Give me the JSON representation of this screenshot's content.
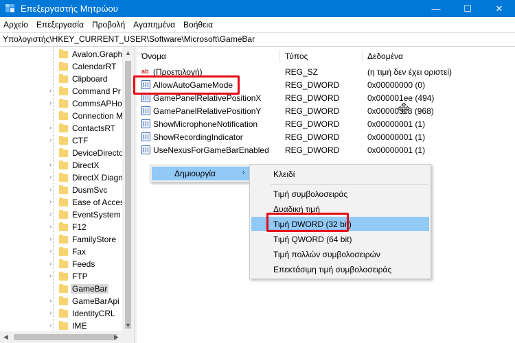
{
  "window": {
    "title": "Επεξεργαστής Μητρώου",
    "accent": "#0078d7",
    "controls": {
      "minimize": "—",
      "maximize": "☐",
      "close": "✕"
    }
  },
  "menubar": {
    "items": [
      "Αρχείο",
      "Επεξεργασία",
      "Προβολή",
      "Αγαπημένα",
      "Βοήθεια"
    ]
  },
  "address": "Υπολογιστής\\HKEY_CURRENT_USER\\Software\\Microsoft\\GameBar",
  "tree": {
    "items": [
      {
        "label": "Avalon.Graph",
        "expandable": false
      },
      {
        "label": "CalendarRT",
        "expandable": false
      },
      {
        "label": "Clipboard",
        "expandable": false
      },
      {
        "label": "Command Pr",
        "expandable": true
      },
      {
        "label": "CommsAPHo",
        "expandable": true
      },
      {
        "label": "Connection M",
        "expandable": false
      },
      {
        "label": "ContactsRT",
        "expandable": true
      },
      {
        "label": "CTF",
        "expandable": true
      },
      {
        "label": "DeviceDirecto",
        "expandable": false
      },
      {
        "label": "DirectX",
        "expandable": true
      },
      {
        "label": "DirectX Diagn",
        "expandable": true
      },
      {
        "label": "DusmSvc",
        "expandable": true
      },
      {
        "label": "Ease of Acces",
        "expandable": true
      },
      {
        "label": "EventSystem",
        "expandable": true
      },
      {
        "label": "F12",
        "expandable": true
      },
      {
        "label": "FamilyStore",
        "expandable": true
      },
      {
        "label": "Fax",
        "expandable": true
      },
      {
        "label": "Feeds",
        "expandable": true
      },
      {
        "label": "FTP",
        "expandable": true
      },
      {
        "label": "GameBar",
        "expandable": false,
        "selected": true
      },
      {
        "label": "GameBarApi",
        "expandable": true
      },
      {
        "label": "IdentityCRL",
        "expandable": true
      },
      {
        "label": "IME",
        "expandable": true
      }
    ]
  },
  "values": {
    "headers": {
      "name": "Όνομα",
      "type": "Τύπος",
      "data": "Δεδομένα"
    },
    "rows": [
      {
        "icon": "string-value-icon",
        "name": "(Προεπιλογή)",
        "type": "REG_SZ",
        "data": "(η τιμή δεν έχει οριστεί)"
      },
      {
        "icon": "dword-value-icon",
        "name": "AllowAutoGameMode",
        "type": "REG_DWORD",
        "data": "0x00000000 (0)",
        "highlighted": true
      },
      {
        "icon": "dword-value-icon",
        "name": "GamePanelRelativePositionX",
        "type": "REG_DWORD",
        "data": "0x000001ee (494)"
      },
      {
        "icon": "dword-value-icon",
        "name": "GamePanelRelativePositionY",
        "type": "REG_DWORD",
        "data": "0x000003c8 (968)"
      },
      {
        "icon": "dword-value-icon",
        "name": "ShowMicrophoneNotification",
        "type": "REG_DWORD",
        "data": "0x00000001 (1)"
      },
      {
        "icon": "dword-value-icon",
        "name": "ShowRecordingIndicator",
        "type": "REG_DWORD",
        "data": "0x00000001 (1)"
      },
      {
        "icon": "dword-value-icon",
        "name": "UseNexusForGameBarEnabled",
        "type": "REG_DWORD",
        "data": "0x00000001 (1)"
      }
    ]
  },
  "context_menu": {
    "item": "Δημιουργία",
    "arrow": "›"
  },
  "submenu": {
    "items": [
      "Κλειδί",
      "Τιμή συμβολοσειράς",
      "Δυαδική τιμή",
      "Τιμή DWORD (32 bit)",
      "Τιμή QWORD (64 bit)",
      "Τιμή πολλών συμβολοσειρών",
      "Επεκτάσιμη τιμή συμβολοσειράς"
    ],
    "active": "Τιμή DWORD (32 bit)"
  },
  "colors": {
    "highlight_box": "#e50914",
    "menu_hover": "#91c9f7",
    "folder": "#f7d471"
  }
}
